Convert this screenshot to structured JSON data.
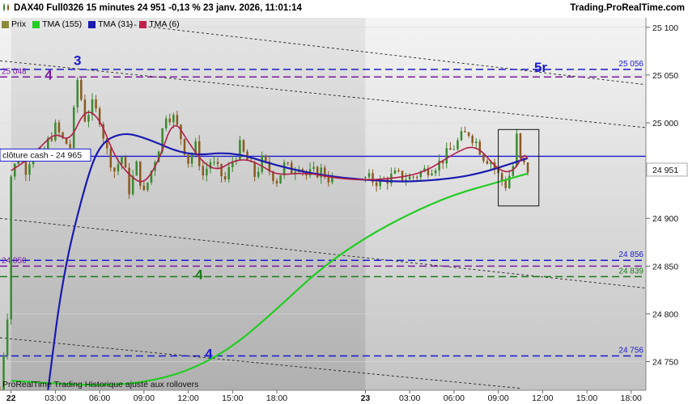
{
  "header": {
    "title": "DAX40 Full0326 15 minutes 24 951 -0,13 % 23 janv. 2026, 11:01:14",
    "brand": "Trading.ProRealTime.com"
  },
  "legend": [
    {
      "label": "Prix",
      "color": "#8a8a3a"
    },
    {
      "label": "TMA (155)",
      "color": "#22cc22"
    },
    {
      "label": "TMA (31)",
      "color": "#1a1ab0"
    },
    {
      "label": "TMA (6)",
      "color": "#c0204a"
    }
  ],
  "footer_note": "ProRealTime Trading  Historique ajusté aux rollovers",
  "colors": {
    "up_candle": "#3a8a30",
    "down_candle": "#8a5a20",
    "tma155": "#22cc22",
    "tma31": "#1a1ab0",
    "tma31_highlight": "#40e8e8",
    "tma6": "#b01e48",
    "tma6_highlight": "#f07a9a",
    "purple_level": "#7a1aa0",
    "blue_level": "#1a1ad0",
    "green_level": "#1a7a1a"
  },
  "chart_data": {
    "type": "line",
    "instrument": "DAX40 Full0326",
    "timeframe": "15 minutes",
    "last_price": 24951,
    "change_pct": -0.13,
    "ylim": [
      24720,
      25110
    ],
    "y_ticks": [
      24750,
      24800,
      24850,
      24900,
      24950,
      25000,
      25050,
      25100
    ],
    "y_tick_labels": [
      "24 750",
      "24 800",
      "24 850",
      "24 900",
      "",
      "25 000",
      "25 050",
      "25 100"
    ],
    "current_price_label": "24 951",
    "x_axis": {
      "start": "2026-01-21 23:15",
      "end": "2026-01-23 19:00",
      "tick_labels": [
        "22",
        "03:00",
        "06:00",
        "09:00",
        "12:00",
        "15:00",
        "18:00",
        "23",
        "03:00",
        "06:00",
        "09:00",
        "12:00",
        "15:00",
        "18:00"
      ],
      "tick_times": [
        "2026-01-22 00:00",
        "2026-01-22 03:00",
        "2026-01-22 06:00",
        "2026-01-22 09:00",
        "2026-01-22 12:00",
        "2026-01-22 15:00",
        "2026-01-22 18:00",
        "2026-01-23 00:00",
        "2026-01-23 03:00",
        "2026-01-23 06:00",
        "2026-01-23 09:00",
        "2026-01-23 12:00",
        "2026-01-23 15:00",
        "2026-01-23 18:00"
      ],
      "bold_labels": [
        "22",
        "23"
      ]
    },
    "shaded_session": {
      "start": "2026-01-22 00:00",
      "end": "2026-01-23 00:00"
    },
    "levels": [
      {
        "price": 25056,
        "style": "dashed",
        "color": "blue",
        "label": "25 056",
        "marker": "5r",
        "extent": "full"
      },
      {
        "price": 25048,
        "style": "dashed",
        "color": "purple",
        "label": "25 048",
        "marker": "4",
        "extent": "full"
      },
      {
        "price": 24965,
        "style": "solid",
        "color": "blue",
        "label": "clôture cash -  24 965",
        "extent": "full"
      },
      {
        "price": 24856,
        "style": "dashed",
        "color": "blue",
        "label": "24 856",
        "extent": "full"
      },
      {
        "price": 24850,
        "style": "dashed",
        "color": "purple",
        "label": "24 850",
        "extent": "full"
      },
      {
        "price": 24839,
        "style": "dashed",
        "color": "green",
        "label": "24 839",
        "marker": "4",
        "extent": "full"
      },
      {
        "price": 24756,
        "style": "dashed",
        "color": "blue",
        "label": "24 756",
        "marker": "4",
        "extent": "full"
      }
    ],
    "wave_labels": [
      {
        "text": "3",
        "time": "2026-01-22 04:30",
        "price": 25062,
        "color": "blue"
      }
    ],
    "trendlines": [
      {
        "from": {
          "time": "2026-01-21 23:15",
          "price": 25065
        },
        "to": {
          "time": "2026-01-23 19:00",
          "price": 24995
        }
      },
      {
        "from": {
          "time": "2026-01-22 08:00",
          "price": 25103
        },
        "to": {
          "time": "2026-01-23 19:00",
          "price": 25040
        }
      },
      {
        "from": {
          "time": "2026-01-21 23:15",
          "price": 24900
        },
        "to": {
          "time": "2026-01-23 19:00",
          "price": 24827
        }
      },
      {
        "from": {
          "time": "2026-01-21 23:15",
          "price": 24775
        },
        "to": {
          "time": "2026-01-23 10:30",
          "price": 24722
        }
      }
    ],
    "box": {
      "time_start": "2026-01-23 09:00",
      "time_end": "2026-01-23 11:45",
      "price_high": 24993,
      "price_low": 24913
    },
    "price_path": [
      [
        "2026-01-21 23:15",
        24720
      ],
      [
        "2026-01-21 23:45",
        24800
      ],
      [
        "2026-01-22 00:00",
        24945
      ],
      [
        "2026-01-22 00:30",
        24965
      ],
      [
        "2026-01-22 01:00",
        24952
      ],
      [
        "2026-01-22 01:30",
        24972
      ],
      [
        "2026-01-22 02:00",
        24965
      ],
      [
        "2026-01-22 02:30",
        24980
      ],
      [
        "2026-01-22 03:00",
        24995
      ],
      [
        "2026-01-22 03:30",
        24982
      ],
      [
        "2026-01-22 04:00",
        24975
      ],
      [
        "2026-01-22 04:30",
        25045
      ],
      [
        "2026-01-22 05:00",
        25005
      ],
      [
        "2026-01-22 05:30",
        25018
      ],
      [
        "2026-01-22 06:00",
        25005
      ],
      [
        "2026-01-22 06:30",
        24970
      ],
      [
        "2026-01-22 07:00",
        24950
      ],
      [
        "2026-01-22 07:30",
        24965
      ],
      [
        "2026-01-22 08:00",
        24930
      ],
      [
        "2026-01-22 08:30",
        24955
      ],
      [
        "2026-01-22 09:00",
        24925
      ],
      [
        "2026-01-22 09:30",
        24950
      ],
      [
        "2026-01-22 10:00",
        24975
      ],
      [
        "2026-01-22 10:30",
        25010
      ],
      [
        "2026-01-22 11:00",
        25005
      ],
      [
        "2026-01-22 11:30",
        24985
      ],
      [
        "2026-01-22 12:00",
        24960
      ],
      [
        "2026-01-22 12:30",
        24975
      ],
      [
        "2026-01-22 13:00",
        24945
      ],
      [
        "2026-01-22 13:30",
        24960
      ],
      [
        "2026-01-22 14:00",
        24950
      ],
      [
        "2026-01-22 14:30",
        24940
      ],
      [
        "2026-01-22 15:00",
        24960
      ],
      [
        "2026-01-22 15:30",
        24975
      ],
      [
        "2026-01-22 16:00",
        24960
      ],
      [
        "2026-01-22 16:30",
        24945
      ],
      [
        "2026-01-22 17:00",
        24960
      ],
      [
        "2026-01-22 17:30",
        24950
      ],
      [
        "2026-01-22 18:00",
        24940
      ],
      [
        "2026-01-22 18:30",
        24955
      ],
      [
        "2026-01-22 19:00",
        24950
      ],
      [
        "2026-01-22 19:30",
        24958
      ],
      [
        "2026-01-22 20:00",
        24945
      ],
      [
        "2026-01-22 21:00",
        24950
      ],
      [
        "2026-01-22 22:00",
        24935
      ],
      [
        "2026-01-23 00:00",
        24942
      ],
      [
        "2026-01-23 01:00",
        24938
      ],
      [
        "2026-01-23 02:00",
        24945
      ],
      [
        "2026-01-23 03:00",
        24942
      ],
      [
        "2026-01-23 04:00",
        24950
      ],
      [
        "2026-01-23 05:00",
        24958
      ],
      [
        "2026-01-23 06:00",
        24975
      ],
      [
        "2026-01-23 06:30",
        24985
      ],
      [
        "2026-01-23 07:00",
        24990
      ],
      [
        "2026-01-23 07:30",
        24980
      ],
      [
        "2026-01-23 08:00",
        24965
      ],
      [
        "2026-01-23 08:30",
        24960
      ],
      [
        "2026-01-23 09:00",
        24945
      ],
      [
        "2026-01-23 09:30",
        24935
      ],
      [
        "2026-01-23 10:00",
        24955
      ],
      [
        "2026-01-23 10:15",
        24985
      ],
      [
        "2026-01-23 10:30",
        24960
      ],
      [
        "2026-01-23 10:45",
        24955
      ],
      [
        "2026-01-23 11:00",
        24951
      ]
    ],
    "series": [
      {
        "name": "TMA (155)",
        "color_key": "tma155",
        "values": [
          [
            "2026-01-22 00:00",
            24730
          ],
          [
            "2026-01-22 03:00",
            24727
          ],
          [
            "2026-01-22 06:00",
            24725
          ],
          [
            "2026-01-22 09:00",
            24728
          ],
          [
            "2026-01-22 12:00",
            24740
          ],
          [
            "2026-01-22 15:00",
            24765
          ],
          [
            "2026-01-22 18:00",
            24805
          ],
          [
            "2026-01-22 21:00",
            24848
          ],
          [
            "2026-01-23 00:00",
            24880
          ],
          [
            "2026-01-23 03:00",
            24905
          ],
          [
            "2026-01-23 06:00",
            24925
          ],
          [
            "2026-01-23 09:00",
            24938
          ],
          [
            "2026-01-23 11:00",
            24947
          ]
        ]
      },
      {
        "name": "TMA (31)",
        "color_key": "tma31",
        "values": [
          [
            "2026-01-22 02:30",
            24720
          ],
          [
            "2026-01-22 03:30",
            24840
          ],
          [
            "2026-01-22 05:00",
            24935
          ],
          [
            "2026-01-22 06:00",
            24978
          ],
          [
            "2026-01-22 07:30",
            24990
          ],
          [
            "2026-01-22 09:00",
            24985
          ],
          [
            "2026-01-22 12:00",
            24965
          ],
          [
            "2026-01-22 15:00",
            24970
          ],
          [
            "2026-01-22 18:00",
            24955
          ],
          [
            "2026-01-22 21:00",
            24945
          ],
          [
            "2026-01-23 00:00",
            24940
          ],
          [
            "2026-01-23 03:00",
            24938
          ],
          [
            "2026-01-23 06:00",
            24942
          ],
          [
            "2026-01-23 08:00",
            24948
          ],
          [
            "2026-01-23 10:00",
            24958
          ],
          [
            "2026-01-23 11:00",
            24963
          ]
        ]
      },
      {
        "name": "TMA (6)",
        "color_key": "tma6",
        "values": [
          [
            "2026-01-22 00:00",
            24950
          ],
          [
            "2026-01-22 01:00",
            24960
          ],
          [
            "2026-01-22 02:00",
            24975
          ],
          [
            "2026-01-22 03:00",
            24990
          ],
          [
            "2026-01-22 04:00",
            24980
          ],
          [
            "2026-01-22 05:00",
            25015
          ],
          [
            "2026-01-22 06:00",
            25005
          ],
          [
            "2026-01-22 07:00",
            24965
          ],
          [
            "2026-01-22 08:00",
            24945
          ],
          [
            "2026-01-22 09:00",
            24935
          ],
          [
            "2026-01-22 10:00",
            24960
          ],
          [
            "2026-01-22 11:00",
            25005
          ],
          [
            "2026-01-22 12:00",
            24980
          ],
          [
            "2026-01-22 13:00",
            24958
          ],
          [
            "2026-01-22 14:00",
            24950
          ],
          [
            "2026-01-22 15:00",
            24960
          ],
          [
            "2026-01-22 16:00",
            24962
          ],
          [
            "2026-01-22 17:00",
            24955
          ],
          [
            "2026-01-22 18:00",
            24945
          ],
          [
            "2026-01-22 20:00",
            24948
          ],
          [
            "2026-01-22 22:00",
            24942
          ],
          [
            "2026-01-23 00:00",
            24940
          ],
          [
            "2026-01-23 02:00",
            24942
          ],
          [
            "2026-01-23 04:00",
            24948
          ],
          [
            "2026-01-23 06:00",
            24968
          ],
          [
            "2026-01-23 07:30",
            24978
          ],
          [
            "2026-01-23 09:00",
            24950
          ],
          [
            "2026-01-23 10:00",
            24948
          ],
          [
            "2026-01-23 10:45",
            24968
          ],
          [
            "2026-01-23 11:00",
            24962
          ]
        ]
      }
    ]
  }
}
